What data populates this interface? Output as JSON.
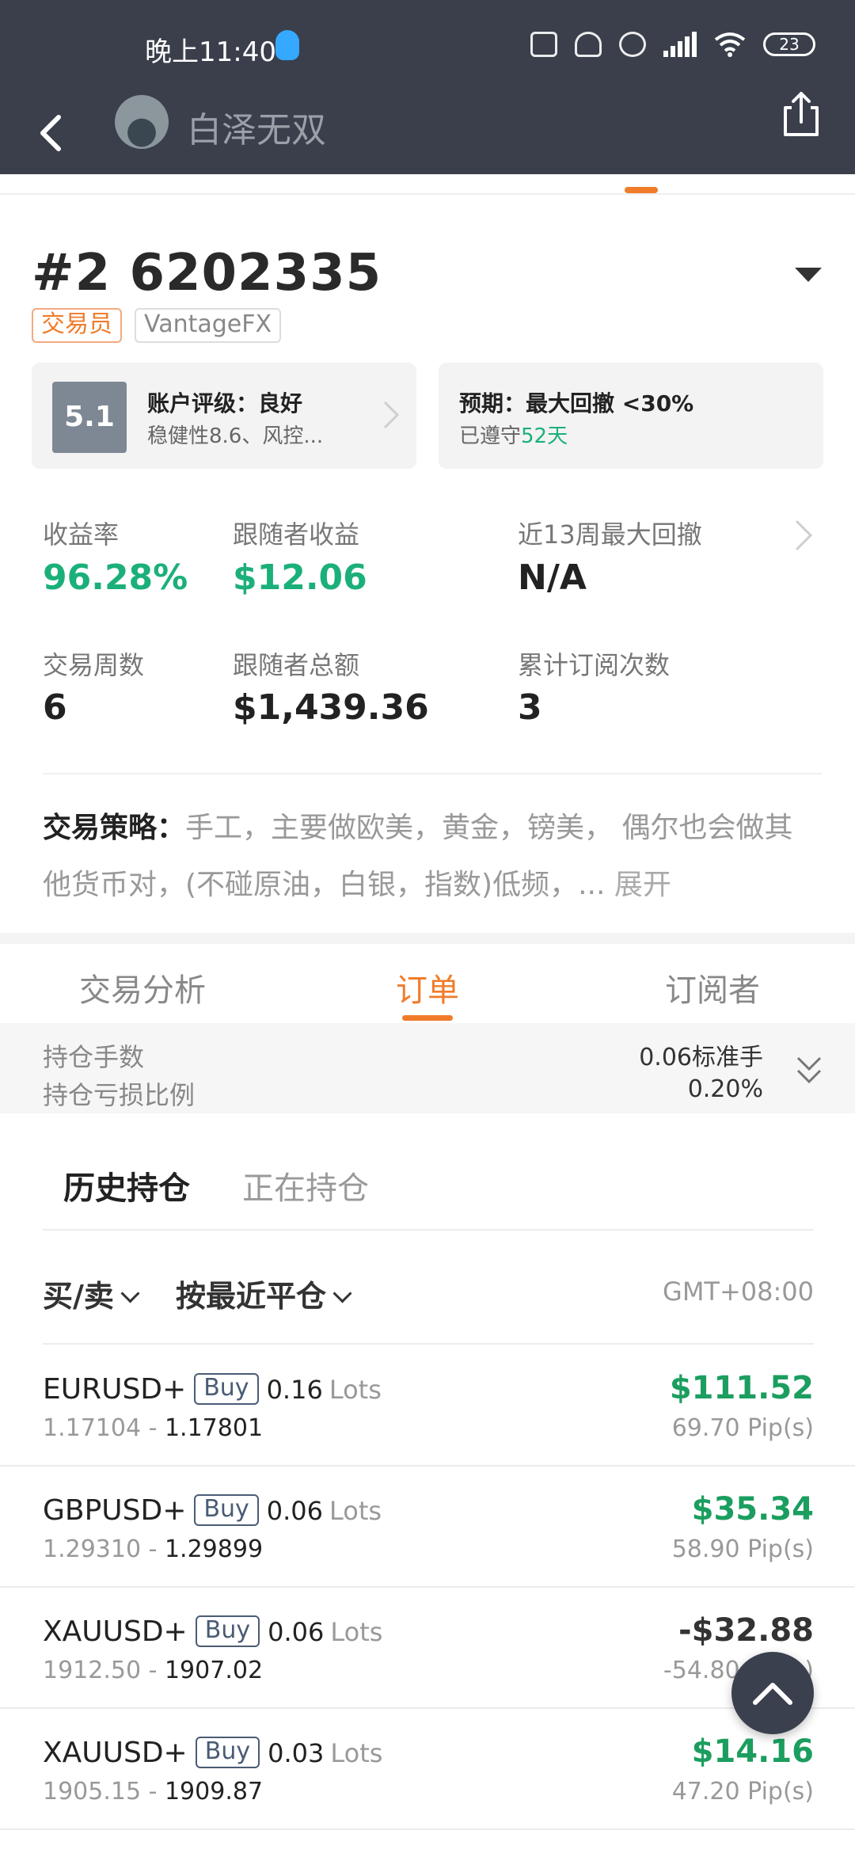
{
  "status_bar": {
    "time": "晚上11:40",
    "battery": "23"
  },
  "header": {
    "name": "白泽无双"
  },
  "account": {
    "title": "#2 6202335",
    "tag_role": "交易员",
    "tag_broker": "VantageFX"
  },
  "rating_card": {
    "score": "5.1",
    "title": "账户评级：良好",
    "subtitle": "稳健性8.6、风控..."
  },
  "expect_card": {
    "title": "预期：最大回撤 <30%",
    "complied_prefix": "已遵守",
    "complied_days": "52天"
  },
  "stats": [
    {
      "label": "收益率",
      "value": "96.28%"
    },
    {
      "label": "跟随者收益",
      "value": "$12.06"
    },
    {
      "label": "近13周最大回撤",
      "value": "N/A"
    },
    {
      "label": "交易周数",
      "value": "6"
    },
    {
      "label": "跟随者总额",
      "value": "$1,439.36"
    },
    {
      "label": "累计订阅次数",
      "value": "3"
    }
  ],
  "strategy": {
    "label": "交易策略：",
    "text": "手工，主要做欧美，黄金，镑美， 偶尔也会做其他货币对，(不碰原油，白银，指数)低频，...",
    "expand": "展开"
  },
  "tabs": [
    "交易分析",
    "订单",
    "订阅者"
  ],
  "summary": {
    "position_lots_label": "持仓手数",
    "position_lots_value": "0.06标准手",
    "position_pl_ratio_label": "持仓亏损比例",
    "position_pl_ratio_value": "0.20%"
  },
  "subtabs": [
    "历史持仓",
    "正在持仓"
  ],
  "filters": {
    "side": "买/卖",
    "sort": "按最近平仓",
    "timezone": "GMT+08:00"
  },
  "orders": [
    {
      "symbol": "EURUSD+",
      "side": "Buy",
      "lots": "0.16",
      "lots_unit": "Lots",
      "open": "1.17104",
      "close": "1.17801",
      "pnl": "$111.52",
      "pips": "69.70 Pip(s)"
    },
    {
      "symbol": "GBPUSD+",
      "side": "Buy",
      "lots": "0.06",
      "lots_unit": "Lots",
      "open": "1.29310",
      "close": "1.29899",
      "pnl": "$35.34",
      "pips": "58.90 Pip(s)"
    },
    {
      "symbol": "XAUUSD+",
      "side": "Buy",
      "lots": "0.06",
      "lots_unit": "Lots",
      "open": "1912.50",
      "close": "1907.02",
      "pnl": "-$32.88",
      "pips": "-54.80 Pip(s)"
    },
    {
      "symbol": "XAUUSD+",
      "side": "Buy",
      "lots": "0.03",
      "lots_unit": "Lots",
      "open": "1905.15",
      "close": "1909.87",
      "pnl": "$14.16",
      "pips": "47.20 Pip(s)"
    }
  ],
  "colors": {
    "header_bg": "#3a3f4b",
    "accent_orange": "#f07c2a",
    "positive_green": "#1bb079"
  }
}
